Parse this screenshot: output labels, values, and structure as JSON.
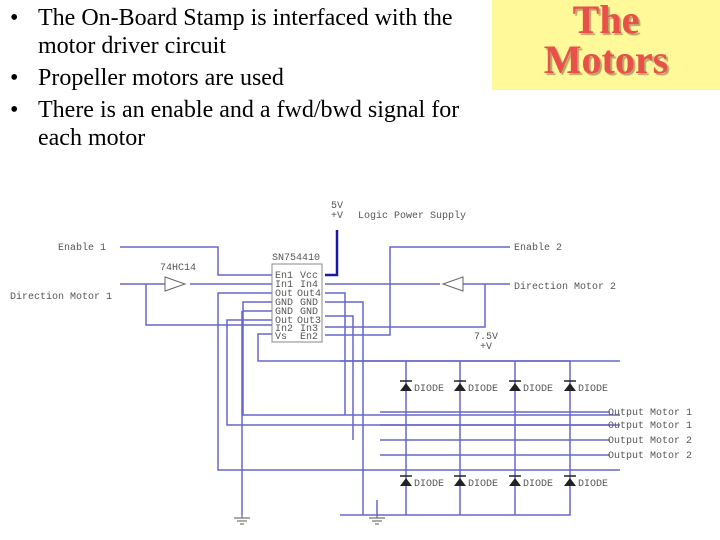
{
  "title": {
    "line1": "The",
    "line2": "Motors"
  },
  "bullets": [
    "The On-Board Stamp is interfaced with the motor driver circuit",
    "Propeller motors are used",
    "There is an enable and a fwd/bwd signal for each motor"
  ],
  "colors": {
    "title_bg": "#fff99a",
    "title_text": "#e8504a",
    "wire": "#6666cc"
  },
  "schematic": {
    "supply_top_voltage": "5V",
    "supply_top_symbol": "+V",
    "logic_supply_label": "Logic Power Supply",
    "enable1": "Enable 1",
    "enable2": "Enable 2",
    "direction1": "Direction Motor 1",
    "direction2": "Direction Motor 2",
    "inverter_label": "74HC14",
    "chip_label": "SN754410",
    "chip_pins_left": [
      "En1",
      "In1",
      "Out",
      "GND",
      "GND",
      "Out",
      "In2",
      "Vs"
    ],
    "chip_pins_right": [
      "Vcc",
      "In4",
      "Out4",
      "GND",
      "GND",
      "Out3",
      "In3",
      "En2"
    ],
    "motor_supply_voltage": "7.5V",
    "motor_supply_symbol": "+V",
    "diode_label": "DIODE",
    "outputs": [
      "Output Motor 1",
      "Output Motor 1",
      "Output Motor 2",
      "Output Motor 2"
    ]
  }
}
